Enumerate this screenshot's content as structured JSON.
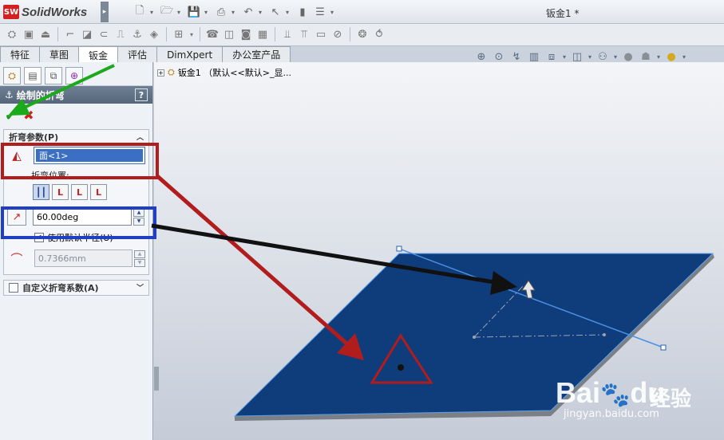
{
  "app": {
    "logo_text": "SolidWorks",
    "logo_badge": "SW",
    "document_title": "钣金1 *"
  },
  "tabs": [
    {
      "label": "特征"
    },
    {
      "label": "草图"
    },
    {
      "label": "钣金",
      "active": true
    },
    {
      "label": "评估"
    },
    {
      "label": "DimXpert"
    },
    {
      "label": "办公室产品"
    }
  ],
  "tree": {
    "expand_glyph": "+",
    "node_label": "钣金1 （默认<<默认>_显..."
  },
  "property_manager": {
    "title": "绘制的折弯",
    "help": "?",
    "ok_glyph": "✔",
    "cancel_glyph": "✖",
    "bend_params": {
      "header": "折弯参数(P)",
      "face_value": "面<1>",
      "bend_position_label": "折弯位置:",
      "angle_value": "60.00deg",
      "use_default_radius": "使用默认半径(U)",
      "use_default_radius_checked": true,
      "radius_value": "0.7366mm"
    },
    "custom_bend": {
      "header": "自定义折弯系数(A)"
    }
  },
  "watermark": {
    "brand": "Bai",
    "brand2": "du",
    "suffix": "经验",
    "url": "jingyan.baidu.com"
  },
  "colors": {
    "plate": "#0f3c7a",
    "plate_edge": "#6d7279",
    "callout_red": "#b11d1d",
    "callout_blue": "#1f3fc4",
    "arrow_green": "#1aaa1a",
    "bend_line": "#4a90e2"
  },
  "icons": {
    "face_selection": "face-select-icon",
    "angle": "angle-icon",
    "radius": "radius-icon"
  }
}
